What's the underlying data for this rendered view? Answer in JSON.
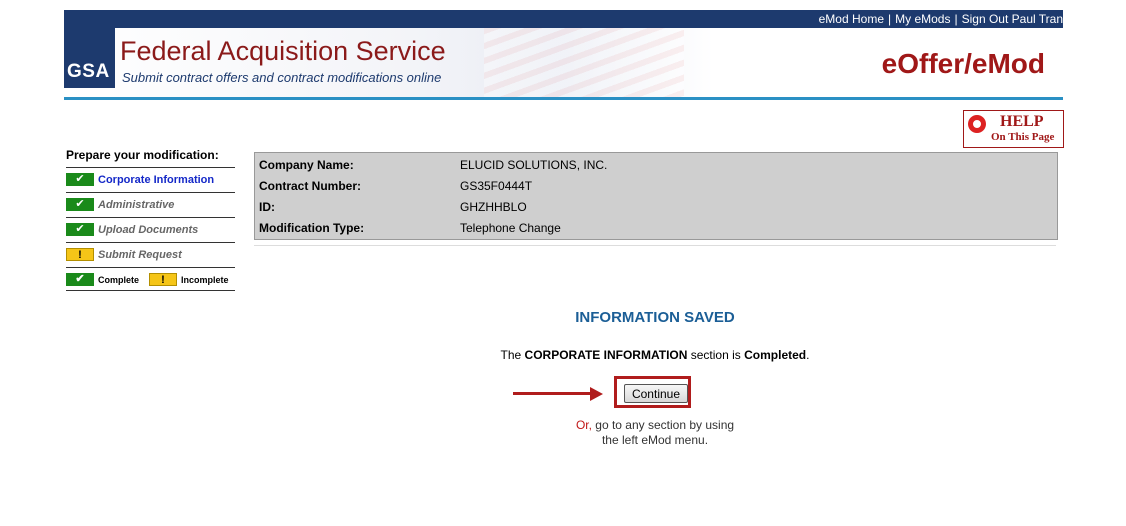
{
  "topnav": {
    "home": "eMod Home",
    "myemods": "My eMods",
    "signout": "Sign Out Paul Tran",
    "sep": "|"
  },
  "banner": {
    "logo": "GSA",
    "title": "Federal Acquisition Service",
    "subtitle": "Submit contract offers and contract modifications online",
    "app": "eOffer/eMod"
  },
  "help": {
    "line1": "HELP",
    "line2": "On This Page"
  },
  "sidebar": {
    "title": "Prepare your modification:",
    "items": [
      {
        "label": "Corporate Information",
        "status": "complete"
      },
      {
        "label": "Administrative",
        "status": "complete"
      },
      {
        "label": "Upload Documents",
        "status": "complete"
      },
      {
        "label": "Submit Request",
        "status": "incomplete"
      }
    ],
    "legend": {
      "complete": "Complete",
      "incomplete": "Incomplete"
    }
  },
  "info": {
    "rows": [
      {
        "key": "Company Name:",
        "value": "ELUCID SOLUTIONS, INC."
      },
      {
        "key": "Contract Number:",
        "value": "GS35F0444T"
      },
      {
        "key": "ID:",
        "value": "GHZHHBLO"
      },
      {
        "key": "Modification Type:",
        "value": "Telephone Change"
      }
    ]
  },
  "main": {
    "heading": "INFORMATION SAVED",
    "msg_pre": "The ",
    "msg_section": "CORPORATE INFORMATION",
    "msg_mid": " section is ",
    "msg_status": "Completed",
    "msg_end": ".",
    "continue": "Continue",
    "or_word": "Or,",
    "or_rest": " go to any section by using",
    "or_line2": "the left eMod menu."
  },
  "colors": {
    "navy": "#1d3a6e",
    "brand_red": "#a01818",
    "accent_blue": "#2a90c4",
    "check_green": "#1a8a1a",
    "warn_yellow": "#f5c518"
  },
  "icons": {
    "check": "check-icon",
    "warning": "warning-icon",
    "help": "life-ring-icon",
    "arrow": "arrow-right-icon"
  }
}
